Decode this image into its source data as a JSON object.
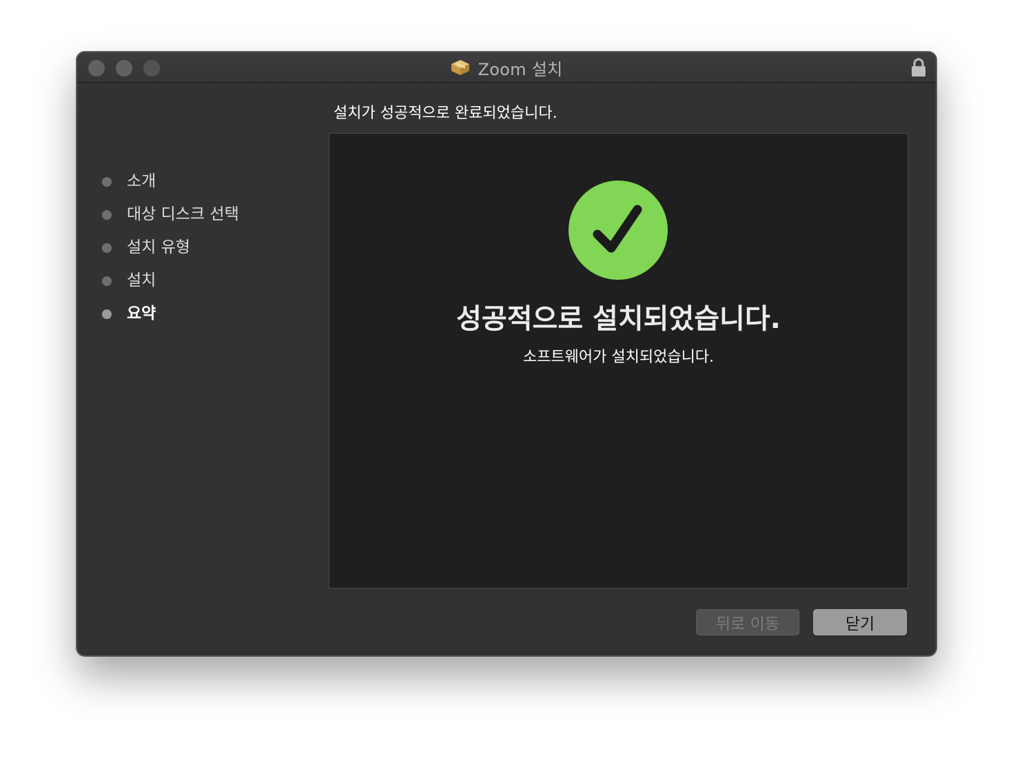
{
  "window": {
    "title": "Zoom 설치",
    "title_icon": "package-icon",
    "lock_icon": "lock-icon"
  },
  "sidebar": {
    "items": [
      {
        "label": "소개",
        "active": false
      },
      {
        "label": "대상 디스크 선택",
        "active": false
      },
      {
        "label": "설치 유형",
        "active": false
      },
      {
        "label": "설치",
        "active": false
      },
      {
        "label": "요약",
        "active": true
      }
    ]
  },
  "main": {
    "heading": "설치가 성공적으로 완료되었습니다.",
    "success_icon": "checkmark-circle-icon",
    "success_title": "성공적으로 설치되었습니다.",
    "success_subtitle": "소프트웨어가 설치되었습니다."
  },
  "buttons": {
    "back_label": "뒤로 이동",
    "close_label": "닫기"
  },
  "colors": {
    "success_green": "#82d655",
    "window_bg": "#323232",
    "panel_bg": "#1f1f1f"
  }
}
